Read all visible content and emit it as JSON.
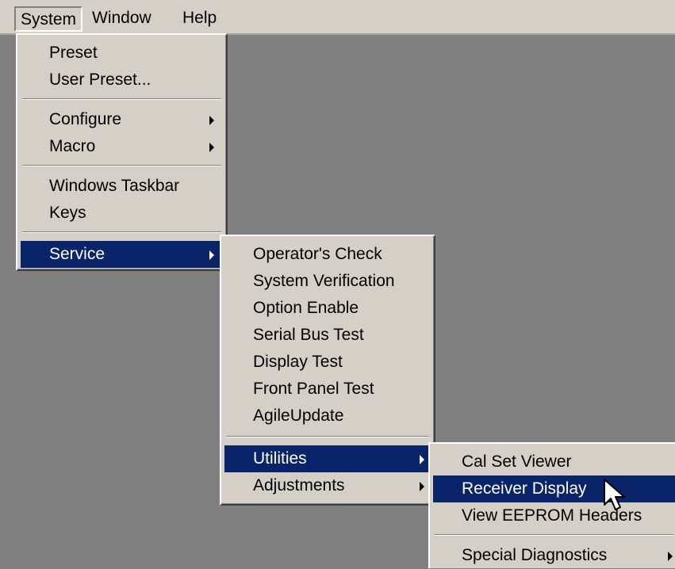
{
  "menubar": {
    "items": [
      {
        "label": "System"
      },
      {
        "label": "Window"
      },
      {
        "label": "Help"
      }
    ]
  },
  "system_menu": {
    "items": [
      {
        "label": "Preset"
      },
      {
        "label": "User Preset..."
      },
      {
        "label": "Configure"
      },
      {
        "label": "Macro"
      },
      {
        "label": "Windows Taskbar"
      },
      {
        "label": "Keys"
      },
      {
        "label": "Service"
      }
    ]
  },
  "service_menu": {
    "items": [
      {
        "label": "Operator's Check"
      },
      {
        "label": "System Verification"
      },
      {
        "label": "Option Enable"
      },
      {
        "label": "Serial Bus Test"
      },
      {
        "label": "Display Test"
      },
      {
        "label": "Front Panel Test"
      },
      {
        "label": "AgileUpdate"
      },
      {
        "label": "Utilities"
      },
      {
        "label": "Adjustments"
      }
    ]
  },
  "utilities_menu": {
    "items": [
      {
        "label": "Cal Set Viewer"
      },
      {
        "label": "Receiver Display"
      },
      {
        "label": "View EEPROM Headers"
      },
      {
        "label": "Special Diagnostics"
      }
    ]
  },
  "colors": {
    "menu_bg": "#d4d0c8",
    "highlight": "#0a246a",
    "desktop": "#808080"
  }
}
